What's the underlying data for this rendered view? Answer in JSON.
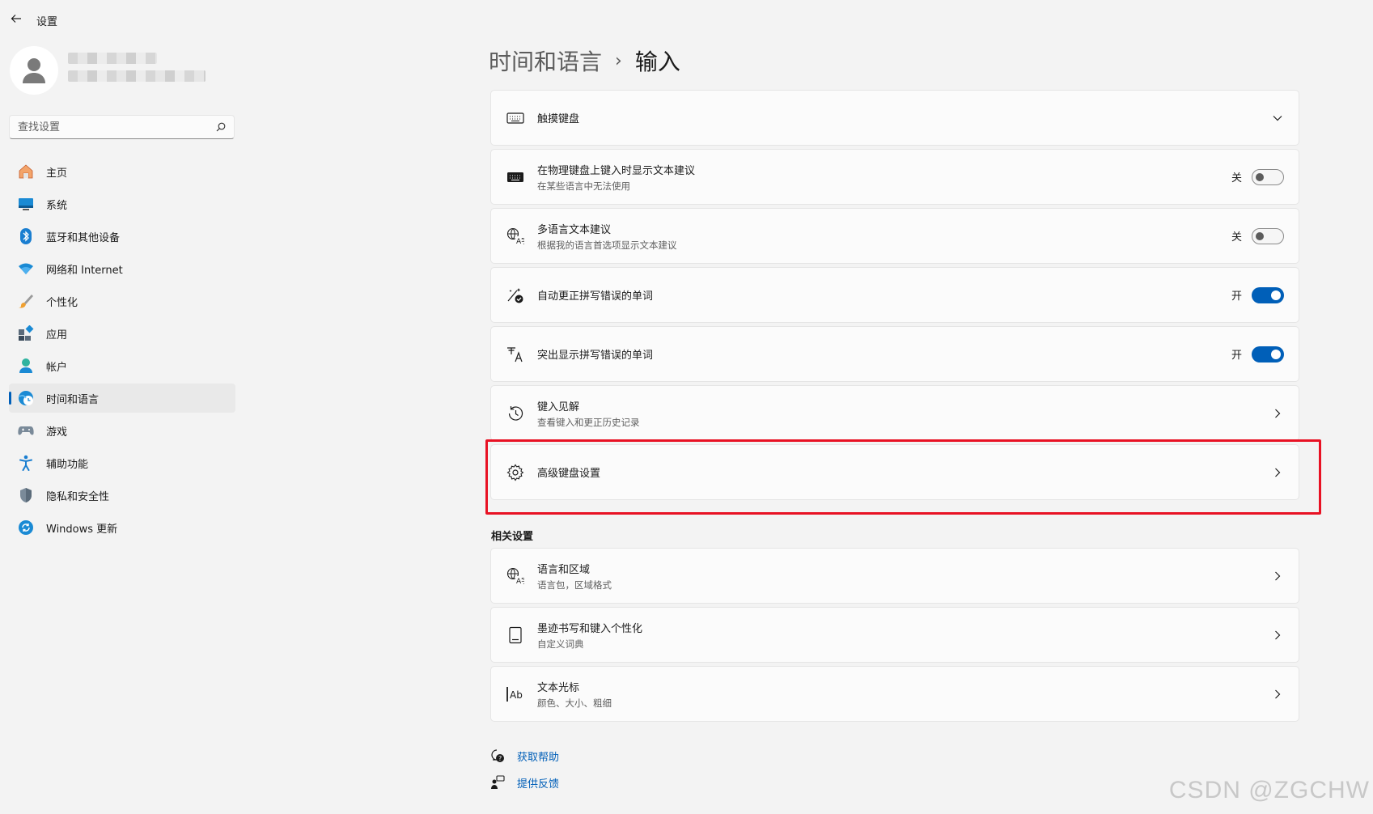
{
  "app": {
    "title": "设置"
  },
  "search": {
    "placeholder": "查找设置"
  },
  "sidebar": {
    "items": [
      {
        "label": "主页",
        "icon": "home-icon"
      },
      {
        "label": "系统",
        "icon": "monitor-icon"
      },
      {
        "label": "蓝牙和其他设备",
        "icon": "bluetooth-icon"
      },
      {
        "label": "网络和 Internet",
        "icon": "wifi-icon"
      },
      {
        "label": "个性化",
        "icon": "brush-icon"
      },
      {
        "label": "应用",
        "icon": "apps-icon"
      },
      {
        "label": "帐户",
        "icon": "account-icon"
      },
      {
        "label": "时间和语言",
        "icon": "globe-clock-icon",
        "active": true
      },
      {
        "label": "游戏",
        "icon": "gamepad-icon"
      },
      {
        "label": "辅助功能",
        "icon": "accessibility-icon"
      },
      {
        "label": "隐私和安全性",
        "icon": "shield-icon"
      },
      {
        "label": "Windows 更新",
        "icon": "update-icon"
      }
    ]
  },
  "header": {
    "parent": "时间和语言",
    "separator": "›",
    "current": "输入"
  },
  "settings": [
    {
      "title": "触摸键盘",
      "subtitle": "",
      "icon": "touch-keyboard-icon",
      "control": "expand"
    },
    {
      "title": "在物理键盘上键入时显示文本建议",
      "subtitle": "在某些语言中无法使用",
      "icon": "keyboard-icon",
      "control": "toggle",
      "state_label": "关",
      "on": false
    },
    {
      "title": "多语言文本建议",
      "subtitle": "根据我的语言首选项显示文本建议",
      "icon": "language-icon",
      "control": "toggle",
      "state_label": "关",
      "on": false
    },
    {
      "title": "自动更正拼写错误的单词",
      "subtitle": "",
      "icon": "autocorrect-icon",
      "control": "toggle",
      "state_label": "开",
      "on": true
    },
    {
      "title": "突出显示拼写错误的单词",
      "subtitle": "",
      "icon": "spellcheck-icon",
      "control": "toggle",
      "state_label": "开",
      "on": true
    },
    {
      "title": "键入见解",
      "subtitle": "查看键入和更正历史记录",
      "icon": "history-icon",
      "control": "chevron"
    },
    {
      "title": "高级键盘设置",
      "subtitle": "",
      "icon": "gear-icon",
      "control": "chevron"
    }
  ],
  "related": {
    "title": "相关设置",
    "items": [
      {
        "title": "语言和区域",
        "subtitle": "语言包，区域格式",
        "icon": "language-icon"
      },
      {
        "title": "墨迹书写和键入个性化",
        "subtitle": "自定义词典",
        "icon": "notebook-icon"
      },
      {
        "title": "文本光标",
        "subtitle": "颜色、大小、粗细",
        "icon": "text-cursor-icon"
      }
    ]
  },
  "links": [
    {
      "label": "获取帮助",
      "icon": "help-icon"
    },
    {
      "label": "提供反馈",
      "icon": "feedback-icon"
    }
  ],
  "watermark": "CSDN @ZGCHW",
  "colors": {
    "accent": "#005fb8",
    "highlight": "#e81123",
    "background": "#f3f3f3",
    "card": "#fbfbfb"
  }
}
